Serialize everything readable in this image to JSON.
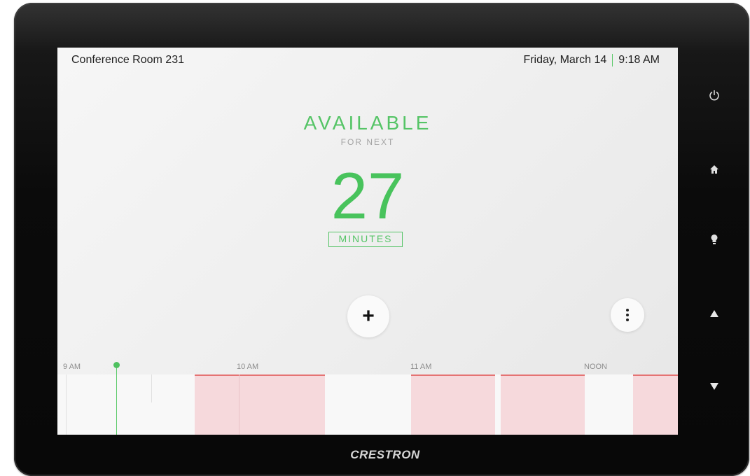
{
  "header": {
    "room_name": "Conference Room 231",
    "date": "Friday, March 14",
    "time": "9:18 AM"
  },
  "status": {
    "label": "AVAILABLE",
    "sub_label": "FOR NEXT",
    "minutes_value": "27",
    "unit": "MINUTES",
    "color": "#55c466"
  },
  "actions": {
    "add_icon": "plus-icon",
    "add_symbol": "+",
    "more_icon": "vertical-dots-icon"
  },
  "timeline": {
    "labels": [
      "9 AM",
      "10 AM",
      "11 AM",
      "NOON"
    ],
    "booked_color": "#f6d9dc",
    "booked_accent": "#e57373",
    "now_color": "#4fc160"
  },
  "hardware_buttons": [
    "power-icon",
    "home-icon",
    "lightbulb-icon",
    "up-arrow-icon",
    "down-arrow-icon"
  ],
  "brand": "CRESTRON"
}
